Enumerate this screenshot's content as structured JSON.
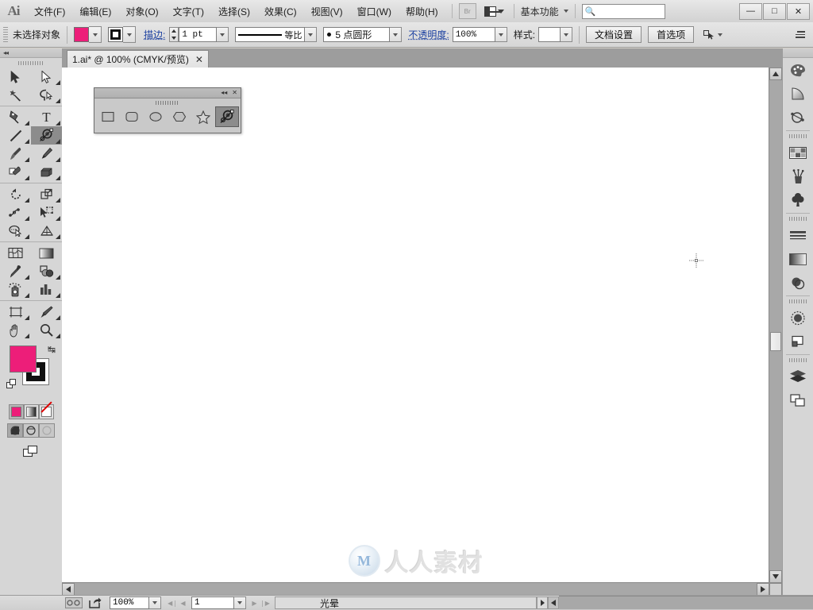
{
  "app": {
    "logo": "Ai",
    "title": "Adobe Illustrator"
  },
  "menubar": {
    "items": [
      {
        "label": "文件(F)",
        "name": "menu-file"
      },
      {
        "label": "编辑(E)",
        "name": "menu-edit"
      },
      {
        "label": "对象(O)",
        "name": "menu-object"
      },
      {
        "label": "文字(T)",
        "name": "menu-type"
      },
      {
        "label": "选择(S)",
        "name": "menu-select"
      },
      {
        "label": "效果(C)",
        "name": "menu-effect"
      },
      {
        "label": "视图(V)",
        "name": "menu-view"
      },
      {
        "label": "窗口(W)",
        "name": "menu-window"
      },
      {
        "label": "帮助(H)",
        "name": "menu-help"
      }
    ],
    "bridge_label": "Br",
    "workspace": "基本功能",
    "search_placeholder": "",
    "search_value": "",
    "window_minimize": "—",
    "window_maximize": "□",
    "window_close": "✕"
  },
  "controlbar": {
    "selection_status": "未选择对象",
    "fill_color": "#ED1E79",
    "fill_color_label": "洋红",
    "stroke_color": "#000000",
    "stroke_label": "描边:",
    "stroke_weight": "1 pt",
    "profile_label": "等比",
    "brush_label": "5 点圆形",
    "opacity_label": "不透明度:",
    "opacity_value": "100%",
    "style_label": "样式:",
    "doc_setup_button": "文档设置",
    "preferences_button": "首选项"
  },
  "tabbar": {
    "tab_title": "1.ai* @ 100% (CMYK/预览)",
    "tab_close": "✕"
  },
  "toolbar": {
    "collapse": "◂◂",
    "tools": [
      {
        "name": "selection-tool",
        "label": "选择工具",
        "selected": false
      },
      {
        "name": "direct-selection-tool",
        "label": "直接选择工具",
        "selected": false
      },
      {
        "name": "magic-wand-tool",
        "label": "魔棒工具",
        "selected": false
      },
      {
        "name": "lasso-tool",
        "label": "套索工具",
        "selected": false
      },
      {
        "name": "pen-tool",
        "label": "钢笔工具",
        "selected": false
      },
      {
        "name": "type-tool",
        "label": "文字工具",
        "selected": false
      },
      {
        "name": "line-segment-tool",
        "label": "直线段工具",
        "selected": false
      },
      {
        "name": "flare-tool",
        "label": "光晕工具",
        "selected": true
      },
      {
        "name": "paintbrush-tool",
        "label": "画笔工具",
        "selected": false
      },
      {
        "name": "pencil-tool",
        "label": "铅笔工具",
        "selected": false
      },
      {
        "name": "blob-brush-tool",
        "label": "斑点画笔工具",
        "selected": false
      },
      {
        "name": "eraser-tool",
        "label": "橡皮擦工具",
        "selected": false
      },
      {
        "name": "rotate-tool",
        "label": "旋转工具",
        "selected": false
      },
      {
        "name": "scale-tool",
        "label": "比例缩放工具",
        "selected": false
      },
      {
        "name": "width-tool",
        "label": "宽度工具",
        "selected": false
      },
      {
        "name": "free-transform-tool",
        "label": "自由变换工具",
        "selected": false
      },
      {
        "name": "shape-builder-tool",
        "label": "形状生成器工具",
        "selected": false
      },
      {
        "name": "perspective-grid-tool",
        "label": "透视网格工具",
        "selected": false
      },
      {
        "name": "mesh-tool",
        "label": "网格工具",
        "selected": false
      },
      {
        "name": "gradient-tool",
        "label": "渐变工具",
        "selected": false
      },
      {
        "name": "eyedropper-tool",
        "label": "吸管工具",
        "selected": false
      },
      {
        "name": "blend-tool",
        "label": "混合工具",
        "selected": false
      },
      {
        "name": "symbol-sprayer-tool",
        "label": "符号喷枪工具",
        "selected": false
      },
      {
        "name": "column-graph-tool",
        "label": "柱形图工具",
        "selected": false
      },
      {
        "name": "artboard-tool",
        "label": "画板工具",
        "selected": false
      },
      {
        "name": "slice-tool",
        "label": "切片工具",
        "selected": false
      },
      {
        "name": "hand-tool",
        "label": "抓手工具",
        "selected": false
      },
      {
        "name": "zoom-tool",
        "label": "缩放工具",
        "selected": false
      }
    ],
    "fill_color": "#ED1E79",
    "stroke_color": "#000000",
    "swap_icon": "↹",
    "color_modes": [
      {
        "name": "fill-color-mode",
        "label": "颜色",
        "active": true
      },
      {
        "name": "gradient-mode",
        "label": "渐变",
        "active": false
      },
      {
        "name": "none-mode",
        "label": "无",
        "active": false
      }
    ],
    "screen_modes": [
      {
        "name": "normal-screen-mode",
        "label": "正常屏幕模式",
        "active": true
      },
      {
        "name": "fullscreen-menubar-mode",
        "label": "带有菜单栏的全屏模式",
        "active": false
      },
      {
        "name": "fullscreen-mode",
        "label": "全屏模式",
        "active": false
      }
    ],
    "change-screen-mode": "更改屏幕模式"
  },
  "shape_palette": {
    "collapse": "◂◂",
    "close": "✕",
    "tools": [
      {
        "name": "rectangle-tool",
        "label": "矩形工具",
        "selected": false
      },
      {
        "name": "rounded-rectangle-tool",
        "label": "圆角矩形工具",
        "selected": false
      },
      {
        "name": "ellipse-tool",
        "label": "椭圆工具",
        "selected": false
      },
      {
        "name": "polygon-tool",
        "label": "多边形工具",
        "selected": false
      },
      {
        "name": "star-tool",
        "label": "星形工具",
        "selected": false
      },
      {
        "name": "flare-tool",
        "label": "光晕工具",
        "selected": true
      }
    ]
  },
  "right_dock": {
    "panels": [
      {
        "name": "color-panel",
        "label": "颜色"
      },
      {
        "name": "color-guide-panel",
        "label": "颜色参考"
      },
      {
        "name": "symbols-panel",
        "label": "符号"
      },
      {
        "name": "swatches-panel",
        "label": "色板"
      },
      {
        "name": "brushes-panel",
        "label": "画笔"
      },
      {
        "name": "symbols-library-panel",
        "label": "符号库"
      },
      {
        "name": "stroke-panel",
        "label": "描边"
      },
      {
        "name": "gradient-panel",
        "label": "渐变"
      },
      {
        "name": "transparency-panel",
        "label": "透明度"
      },
      {
        "name": "appearance-panel",
        "label": "外观"
      },
      {
        "name": "graphic-styles-panel",
        "label": "图形样式"
      },
      {
        "name": "layers-panel",
        "label": "图层"
      },
      {
        "name": "artboards-panel",
        "label": "画板"
      }
    ]
  },
  "canvas": {
    "watermark_logo": "M",
    "watermark_text": "人人素材"
  },
  "statusbar": {
    "zoom_value": "100%",
    "page_value": "1",
    "status_text": "光晕",
    "first_page": "◀❘",
    "prev_page": "◀",
    "next_page": "▶",
    "last_page": "❘▶"
  },
  "colors": {
    "accent_magenta": "#ED1E79",
    "chrome_gray": "#d6d6d6",
    "tabstrip_gray": "#9d9d9d",
    "canvas_white": "#ffffff"
  }
}
